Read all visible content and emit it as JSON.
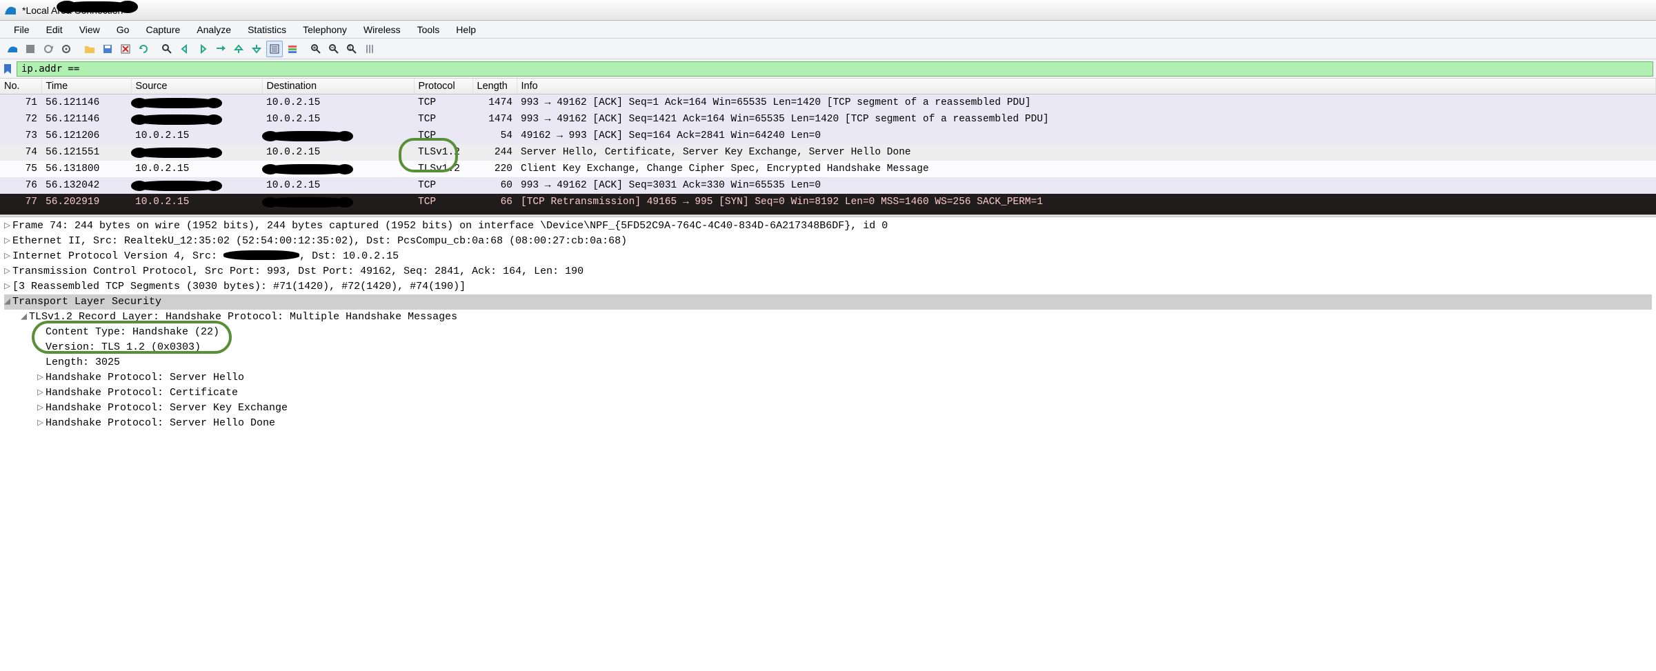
{
  "title": "*Local Area Connection",
  "menu": [
    "File",
    "Edit",
    "View",
    "Go",
    "Capture",
    "Analyze",
    "Statistics",
    "Telephony",
    "Wireless",
    "Tools",
    "Help"
  ],
  "filter_value": "ip.addr == ",
  "columns": [
    "No.",
    "Time",
    "Source",
    "Destination",
    "Protocol",
    "Length",
    "Info"
  ],
  "packets": [
    {
      "no": "71",
      "time": "56.121146",
      "src": "[redacted]",
      "dst": "10.0.2.15",
      "proto": "TCP",
      "len": "1474",
      "info": "993 → 49162 [ACK] Seq=1 Ack=164 Win=65535 Len=1420 [TCP segment of a reassembled PDU]",
      "row": "even"
    },
    {
      "no": "72",
      "time": "56.121146",
      "src": "[redacted]",
      "dst": "10.0.2.15",
      "proto": "TCP",
      "len": "1474",
      "info": "993 → 49162 [ACK] Seq=1421 Ack=164 Win=65535 Len=1420 [TCP segment of a reassembled PDU]",
      "row": "even"
    },
    {
      "no": "73",
      "time": "56.121206",
      "src": "10.0.2.15",
      "dst": "[redacted]",
      "proto": "TCP",
      "len": "54",
      "info": "49162 → 993 [ACK] Seq=164 Ack=2841 Win=64240 Len=0",
      "row": "even"
    },
    {
      "no": "74",
      "time": "56.121551",
      "src": "[redacted]",
      "dst": "10.0.2.15",
      "proto": "TLSv1.2",
      "len": "244",
      "info": "Server Hello, Certificate, Server Key Exchange, Server Hello Done",
      "row": "sel"
    },
    {
      "no": "75",
      "time": "56.131800",
      "src": "10.0.2.15",
      "dst": "[redacted]",
      "proto": "TLSv1.2",
      "len": "220",
      "info": "Client Key Exchange, Change Cipher Spec, Encrypted Handshake Message",
      "row": "odd"
    },
    {
      "no": "76",
      "time": "56.132042",
      "src": "[redacted]",
      "dst": "10.0.2.15",
      "proto": "TCP",
      "len": "60",
      "info": "993 → 49162 [ACK] Seq=3031 Ack=330 Win=65535 Len=0",
      "row": "even"
    },
    {
      "no": "77",
      "time": "56.202919",
      "src": "10.0.2.15",
      "dst": "[redacted]",
      "proto": "TCP",
      "len": "66",
      "info": "[TCP Retransmission] 49165 → 995 [SYN] Seq=0 Win=8192 Len=0 MSS=1460 WS=256 SACK_PERM=1",
      "row": "dark"
    }
  ],
  "detail": {
    "frame": "Frame 74: 244 bytes on wire (1952 bits), 244 bytes captured (1952 bits) on interface \\Device\\NPF_{5FD52C9A-764C-4C40-834D-6A217348B6DF}, id 0",
    "eth": "Ethernet II, Src: RealtekU_12:35:02 (52:54:00:12:35:02), Dst: PcsCompu_cb:0a:68 (08:00:27:cb:0a:68)",
    "ip_pre": "Internet Protocol Version 4, Src: ",
    "ip_post": ", Dst: 10.0.2.15",
    "tcp": "Transmission Control Protocol, Src Port: 993, Dst Port: 49162, Seq: 2841, Ack: 164, Len: 190",
    "reasm": "[3 Reassembled TCP Segments (3030 bytes): #71(1420), #72(1420), #74(190)]",
    "tls": "Transport Layer Security",
    "tls_record": "TLSv1.2 Record Layer: Handshake Protocol: Multiple Handshake Messages",
    "ct": "Content Type: Handshake (22)",
    "ver": "Version: TLS 1.2 (0x0303)",
    "len": "Length: 3025",
    "hs1": "Handshake Protocol: Server Hello",
    "hs2": "Handshake Protocol: Certificate",
    "hs3": "Handshake Protocol: Server Key Exchange",
    "hs4": "Handshake Protocol: Server Hello Done"
  }
}
